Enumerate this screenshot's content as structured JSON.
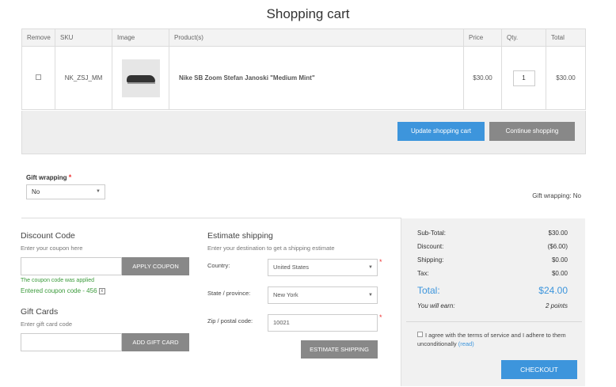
{
  "page": {
    "title": "Shopping cart"
  },
  "cart": {
    "headers": {
      "remove": "Remove",
      "sku": "SKU",
      "image": "Image",
      "product": "Product(s)",
      "price": "Price",
      "qty": "Qty.",
      "total": "Total"
    },
    "items": [
      {
        "sku": "NK_ZSJ_MM",
        "product": "Nike SB Zoom Stefan Janoski \"Medium Mint\"",
        "price": "$30.00",
        "qty": "1",
        "total": "$30.00",
        "image_icon": "sneaker-image"
      }
    ],
    "update_label": "Update shopping cart",
    "continue_label": "Continue shopping"
  },
  "gift_wrapping": {
    "label": "Gift wrapping",
    "required_mark": "*",
    "selected": "No",
    "summary": "Gift wrapping: No"
  },
  "discount": {
    "title": "Discount Code",
    "hint": "Enter your coupon here",
    "apply_label": "APPLY COUPON",
    "applied_msg": "The coupon code was applied",
    "entered_code": "Entered coupon code - 456",
    "remove_glyph": "x"
  },
  "gift_cards": {
    "title": "Gift Cards",
    "hint": "Enter gift card code",
    "add_label": "ADD GIFT CARD"
  },
  "shipping": {
    "title": "Estimate shipping",
    "hint": "Enter your destination to get a shipping estimate",
    "country_label": "Country:",
    "country_value": "United States",
    "state_label": "State / province:",
    "state_value": "New York",
    "zip_label": "Zip / postal code:",
    "zip_value": "10021",
    "required_mark": "*",
    "estimate_label": "ESTIMATE SHIPPING"
  },
  "totals": {
    "subtotal_label": "Sub-Total:",
    "subtotal": "$30.00",
    "discount_label": "Discount:",
    "discount": "($6.00)",
    "shipping_label": "Shipping:",
    "shipping": "$0.00",
    "tax_label": "Tax:",
    "tax": "$0.00",
    "total_label": "Total:",
    "total": "$24.00",
    "earn_label": "You will earn:",
    "earn": "2 points",
    "terms_text": "I agree with the terms of service and I adhere to them unconditionally",
    "read_link": "(read)",
    "checkout_label": "CHECKOUT"
  },
  "colors": {
    "accent": "#3d95dc",
    "button_gray": "#888888",
    "success": "#3a9a3a",
    "required": "#e33333"
  }
}
